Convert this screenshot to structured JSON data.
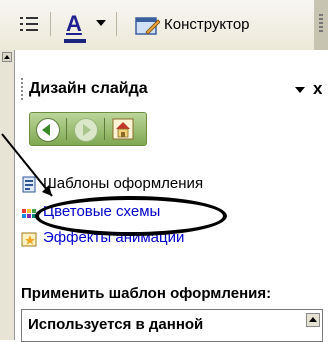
{
  "toolbar": {
    "font_color_letter": "A",
    "designer_label": "Конструктор",
    "icons": [
      "indent-icon",
      "font-color-icon",
      "chevron-down-icon",
      "designer-icon"
    ]
  },
  "pane": {
    "title": "Дизайн слайда",
    "close_label": "x",
    "nav": [
      "back-icon",
      "forward-icon",
      "home-icon"
    ],
    "links": {
      "templates": "Шаблоны оформления",
      "color_schemes": "Цветовые схемы",
      "animation_effects": "Эффекты анимации"
    },
    "apply_template_label": "Применить шаблон оформления:",
    "list_section_label": "Используется в данной"
  },
  "colors": {
    "link": "#0000cc",
    "nav_green": "#7fa852",
    "font_color_bar": "#1a237e"
  }
}
